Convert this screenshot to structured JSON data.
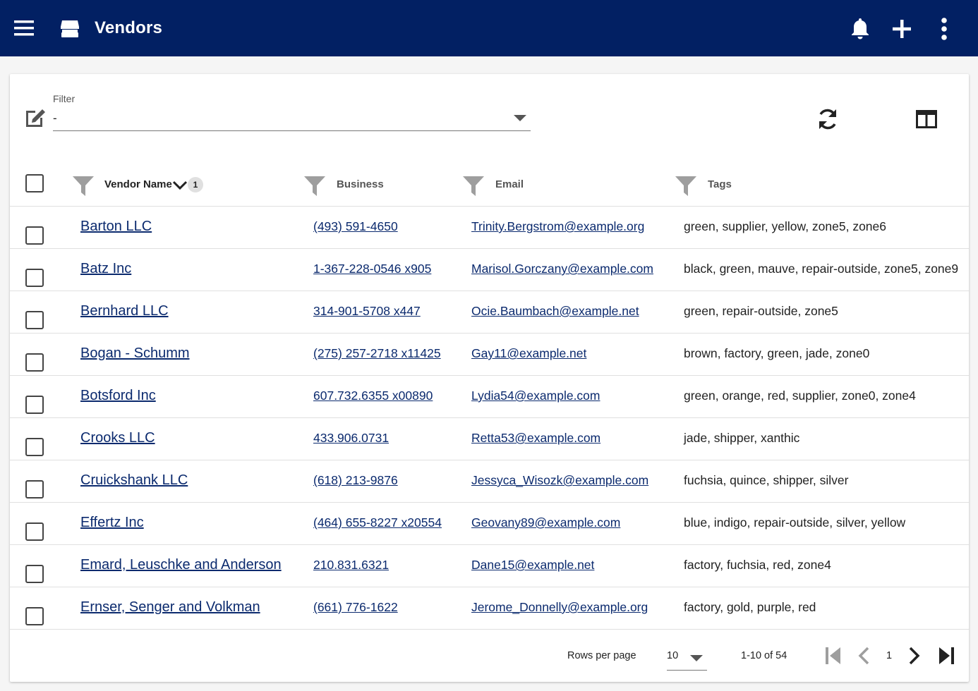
{
  "app": {
    "title": "Vendors",
    "icons": {
      "menu": "menu-icon",
      "store": "store-icon",
      "notifications": "bell-icon",
      "add": "plus-icon",
      "more": "more-vert-icon"
    }
  },
  "filter": {
    "label": "Filter",
    "value": "-"
  },
  "table": {
    "columns": [
      {
        "label": "Vendor Name",
        "sorted": "desc",
        "sort_order": "1"
      },
      {
        "label": "Business"
      },
      {
        "label": "Email"
      },
      {
        "label": "Tags"
      }
    ],
    "rows": [
      {
        "name": "Barton LLC",
        "phone": "(493) 591-4650",
        "email": "Trinity.Bergstrom@example.org",
        "tags": "green, supplier, yellow, zone5, zone6"
      },
      {
        "name": "Batz Inc",
        "phone": "1-367-228-0546 x905",
        "email": "Marisol.Gorczany@example.com",
        "tags": "black, green, mauve, repair-outside, zone5, zone9"
      },
      {
        "name": "Bernhard LLC",
        "phone": "314-901-5708 x447",
        "email": "Ocie.Baumbach@example.net",
        "tags": "green, repair-outside, zone5"
      },
      {
        "name": "Bogan - Schumm",
        "phone": "(275) 257-2718 x11425",
        "email": "Gay11@example.net",
        "tags": "brown, factory, green, jade, zone0"
      },
      {
        "name": "Botsford Inc",
        "phone": "607.732.6355 x00890",
        "email": "Lydia54@example.com",
        "tags": "green, orange, red, supplier, zone0, zone4"
      },
      {
        "name": "Crooks LLC",
        "phone": "433.906.0731",
        "email": "Retta53@example.com",
        "tags": "jade, shipper, xanthic"
      },
      {
        "name": "Cruickshank LLC",
        "phone": "(618) 213-9876",
        "email": "Jessyca_Wisozk@example.com",
        "tags": "fuchsia, quince, shipper, silver"
      },
      {
        "name": "Effertz Inc",
        "phone": "(464) 655-8227 x20554",
        "email": "Geovany89@example.com",
        "tags": "blue, indigo, repair-outside, silver, yellow"
      },
      {
        "name": "Emard, Leuschke and Anderson",
        "phone": "210.831.6321",
        "email": "Dane15@example.net",
        "tags": "factory, fuchsia, red, zone4"
      },
      {
        "name": "Ernser, Senger and Volkman",
        "phone": "(661) 776-1622",
        "email": "Jerome_Donnelly@example.org",
        "tags": "factory, gold, purple, red"
      }
    ]
  },
  "pagination": {
    "rows_per_page_label": "Rows per page",
    "rows_per_page": "10",
    "range": "1-10 of 54",
    "page": "1"
  },
  "colors": {
    "appbar": "#022063",
    "link": "#0b2a6e",
    "icon_gray": "#9e9e9e"
  }
}
